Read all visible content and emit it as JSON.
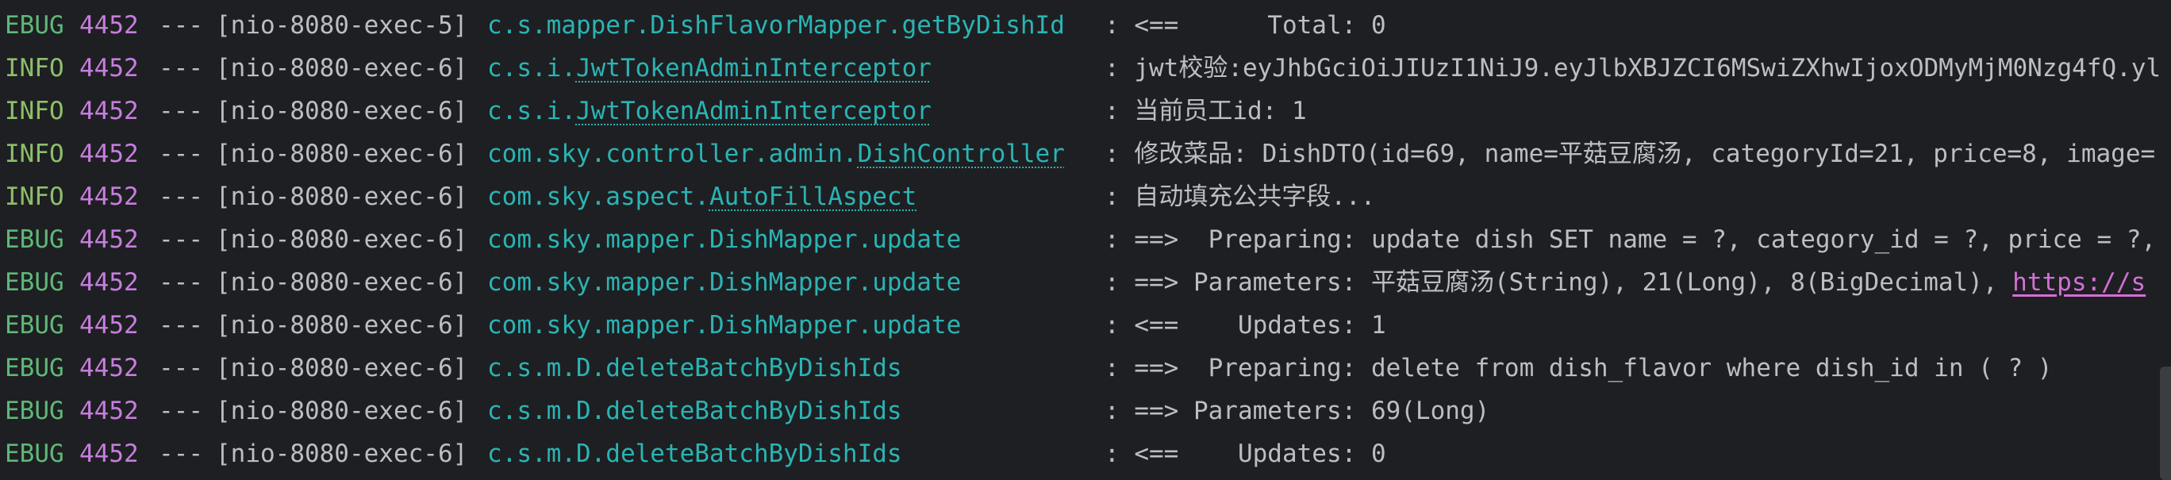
{
  "colors": {
    "background": "#1e1f22",
    "debug_level": "#5fb878",
    "info_level": "#8dbf6b",
    "pid": "#c77dde",
    "logger": "#2ab4b4",
    "message": "#bcbec4",
    "url": "#d36fd6"
  },
  "lines": [
    {
      "level": "EBUG",
      "level_type": "debug",
      "pid": "4452",
      "sep": "---",
      "thread": "[nio-8080-exec-5]",
      "logger_prefix": "c.s.mapper.DishFlavorMapper.getByDishId",
      "logger_link": "",
      "message": ": <==      Total: 0",
      "url": ""
    },
    {
      "level": "INFO",
      "level_type": "info",
      "pid": "4452",
      "sep": "---",
      "thread": "[nio-8080-exec-6]",
      "logger_prefix": "c.s.i.",
      "logger_link": "JwtTokenAdminInterceptor",
      "message": ": jwt校验:eyJhbGciOiJIUzI1NiJ9.eyJlbXBJZCI6MSwiZXhwIjoxODMyMjM0Nzg4fQ.yl",
      "url": ""
    },
    {
      "level": "INFO",
      "level_type": "info",
      "pid": "4452",
      "sep": "---",
      "thread": "[nio-8080-exec-6]",
      "logger_prefix": "c.s.i.",
      "logger_link": "JwtTokenAdminInterceptor",
      "message": ": 当前员工id: 1",
      "url": ""
    },
    {
      "level": "INFO",
      "level_type": "info",
      "pid": "4452",
      "sep": "---",
      "thread": "[nio-8080-exec-6]",
      "logger_prefix": "com.sky.controller.admin.",
      "logger_link": "DishController",
      "message": ": 修改菜品: DishDTO(id=69, name=平菇豆腐汤, categoryId=21, price=8, image=",
      "url": ""
    },
    {
      "level": "INFO",
      "level_type": "info",
      "pid": "4452",
      "sep": "---",
      "thread": "[nio-8080-exec-6]",
      "logger_prefix": "com.sky.aspect.",
      "logger_link": "AutoFillAspect",
      "message": ": 自动填充公共字段...",
      "url": ""
    },
    {
      "level": "EBUG",
      "level_type": "debug",
      "pid": "4452",
      "sep": "---",
      "thread": "[nio-8080-exec-6]",
      "logger_prefix": "com.sky.mapper.DishMapper.update",
      "logger_link": "",
      "message": ": ==>  Preparing: update dish SET name = ?, category_id = ?, price = ?,",
      "url": ""
    },
    {
      "level": "EBUG",
      "level_type": "debug",
      "pid": "4452",
      "sep": "---",
      "thread": "[nio-8080-exec-6]",
      "logger_prefix": "com.sky.mapper.DishMapper.update",
      "logger_link": "",
      "message": ": ==> Parameters: 平菇豆腐汤(String), 21(Long), 8(BigDecimal), ",
      "url": "https://s"
    },
    {
      "level": "EBUG",
      "level_type": "debug",
      "pid": "4452",
      "sep": "---",
      "thread": "[nio-8080-exec-6]",
      "logger_prefix": "com.sky.mapper.DishMapper.update",
      "logger_link": "",
      "message": ": <==    Updates: 1",
      "url": ""
    },
    {
      "level": "EBUG",
      "level_type": "debug",
      "pid": "4452",
      "sep": "---",
      "thread": "[nio-8080-exec-6]",
      "logger_prefix": "c.s.m.D.deleteBatchByDishIds",
      "logger_link": "",
      "message": ": ==>  Preparing: delete from dish_flavor where dish_id in ( ? )",
      "url": ""
    },
    {
      "level": "EBUG",
      "level_type": "debug",
      "pid": "4452",
      "sep": "---",
      "thread": "[nio-8080-exec-6]",
      "logger_prefix": "c.s.m.D.deleteBatchByDishIds",
      "logger_link": "",
      "message": ": ==> Parameters: 69(Long)",
      "url": ""
    },
    {
      "level": "EBUG",
      "level_type": "debug",
      "pid": "4452",
      "sep": "---",
      "thread": "[nio-8080-exec-6]",
      "logger_prefix": "c.s.m.D.deleteBatchByDishIds",
      "logger_link": "",
      "message": ": <==    Updates: 0",
      "url": ""
    }
  ]
}
